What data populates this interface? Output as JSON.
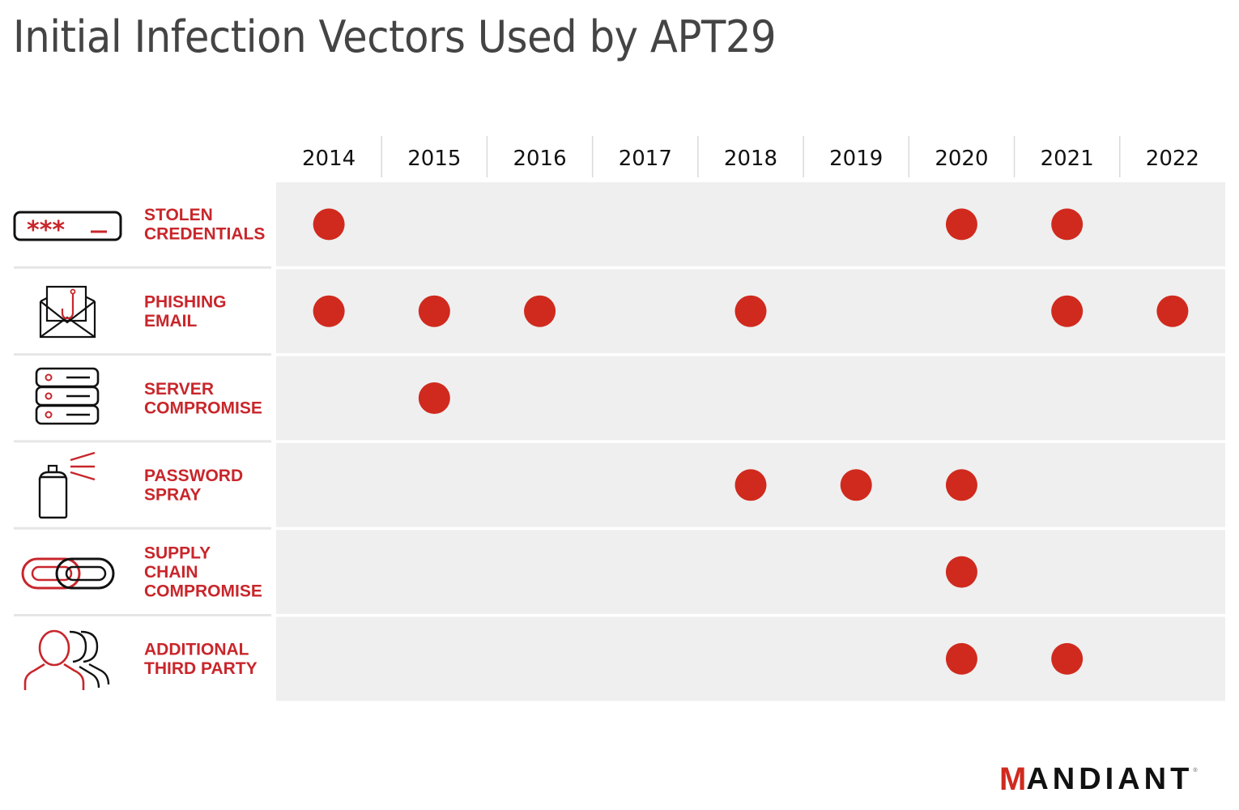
{
  "title": "Initial Infection Vectors Used by APT29",
  "brand": {
    "logo_text_first": "M",
    "logo_text_rest": "ANDIANT",
    "trademark": "®"
  },
  "colors": {
    "accent": "#d02a1e",
    "label": "#c8262b",
    "grid_bg": "#efefef",
    "separator": "#d9d9d9"
  },
  "chart_data": {
    "type": "heatmap",
    "title": "Initial Infection Vectors Used by APT29",
    "xlabel": "",
    "ylabel": "",
    "categories": [
      "2014",
      "2015",
      "2016",
      "2017",
      "2018",
      "2019",
      "2020",
      "2021",
      "2022"
    ],
    "rows": [
      {
        "label_lines": [
          "STOLEN",
          "CREDENTIALS"
        ],
        "icon": "password-field-icon",
        "years": [
          "2014",
          "2020",
          "2021"
        ]
      },
      {
        "label_lines": [
          "PHISHING",
          "EMAIL"
        ],
        "icon": "phishing-envelope-icon",
        "years": [
          "2014",
          "2015",
          "2016",
          "2018",
          "2021",
          "2022"
        ]
      },
      {
        "label_lines": [
          "SERVER",
          "COMPROMISE"
        ],
        "icon": "server-stack-icon",
        "years": [
          "2015"
        ]
      },
      {
        "label_lines": [
          "PASSWORD",
          "SPRAY"
        ],
        "icon": "spray-can-icon",
        "years": [
          "2018",
          "2019",
          "2020"
        ]
      },
      {
        "label_lines": [
          "SUPPLY",
          "CHAIN",
          "COMPROMISE"
        ],
        "icon": "chain-link-icon",
        "years": [
          "2020"
        ]
      },
      {
        "label_lines": [
          "ADDITIONAL",
          "THIRD PARTY"
        ],
        "icon": "people-group-icon",
        "years": [
          "2020",
          "2021"
        ]
      }
    ],
    "legend": "none",
    "grid": false
  }
}
